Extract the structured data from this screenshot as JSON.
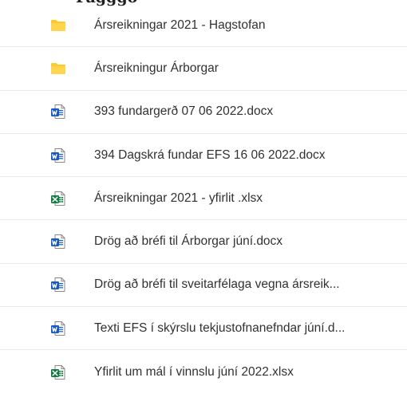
{
  "header": {
    "partial_text": "Fagggö"
  },
  "files": [
    {
      "name": "Ársreikningar 2021 - Hagstofan",
      "type": "folder",
      "icon": "folder-icon"
    },
    {
      "name": "Ársreikningur Árborgar",
      "type": "folder",
      "icon": "folder-icon"
    },
    {
      "name": "393 fundargerð  07 06 2022.docx",
      "type": "word",
      "icon": "word-doc-icon"
    },
    {
      "name": "394 Dagskrá fundar EFS 16 06 2022.docx",
      "type": "word",
      "icon": "word-doc-icon"
    },
    {
      "name": "Ársreikningar 2021 - yfirlit .xlsx",
      "type": "excel",
      "icon": "excel-sheet-icon"
    },
    {
      "name": "Drög að bréfi til Árborgar júní.docx",
      "type": "word",
      "icon": "word-doc-icon"
    },
    {
      "name": "Drög að bréfi til sveitarfélaga vegna ársreik...",
      "type": "word",
      "icon": "word-doc-icon"
    },
    {
      "name": "Texti EFS í skýrslu tekjustofnanefndar júní.d...",
      "type": "word",
      "icon": "word-doc-icon"
    },
    {
      "name": "Yfirlit um mál í vinnslu júní 2022.xlsx",
      "type": "excel",
      "icon": "excel-sheet-icon"
    }
  ],
  "colors": {
    "folder": "#FFCA28",
    "word": "#185ABD",
    "excel": "#107C41",
    "text": "#323130",
    "divider": "#EDEBE9"
  }
}
